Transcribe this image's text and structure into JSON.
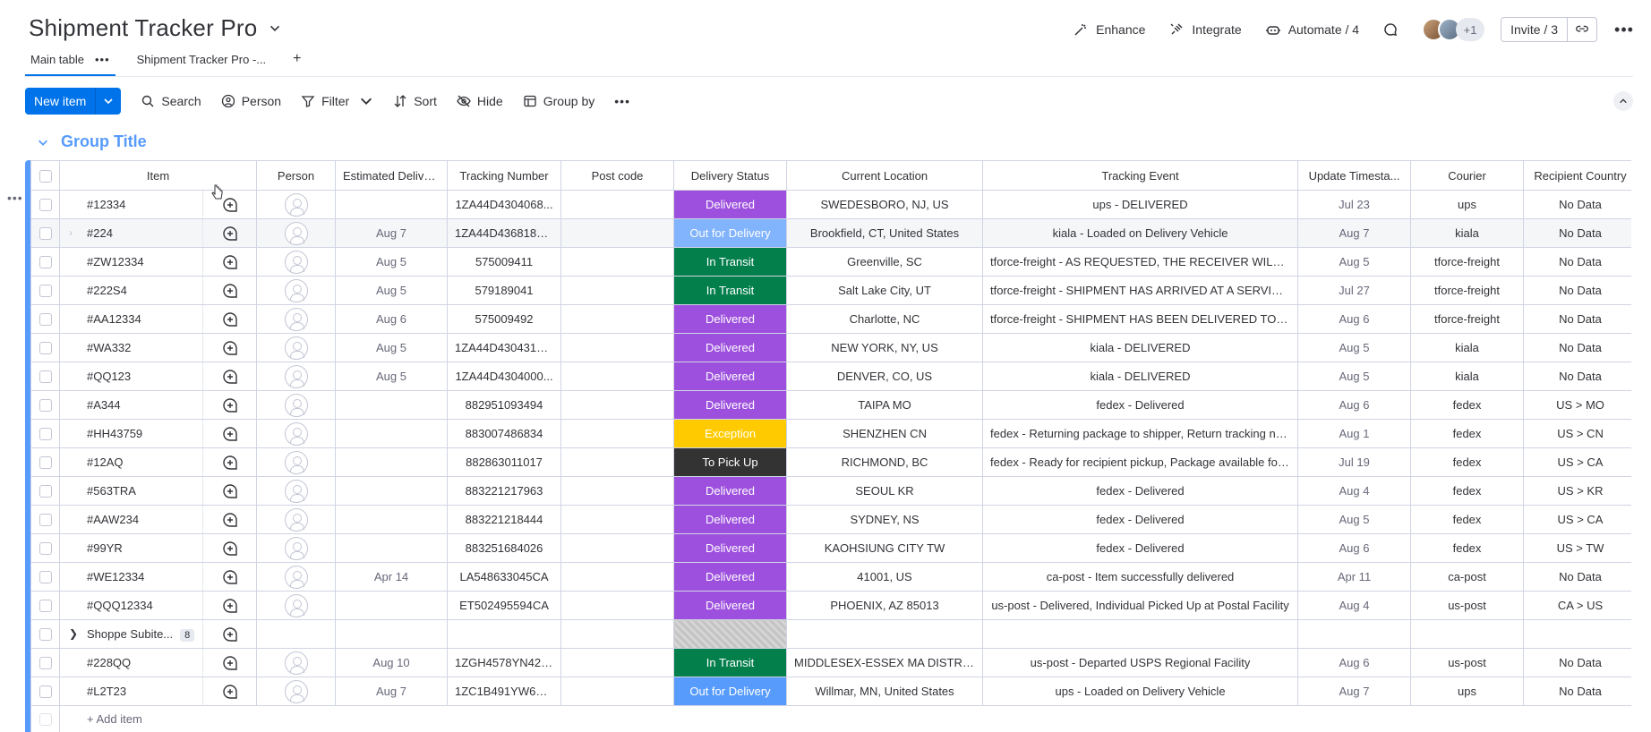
{
  "board": {
    "title": "Shipment Tracker Pro"
  },
  "top_actions": {
    "enhance": "Enhance",
    "integrate": "Integrate",
    "automate": "Automate / 4",
    "avatar_more": "+1",
    "invite": "Invite / 3"
  },
  "view_tabs": {
    "main": "Main table",
    "second": "Shipment Tracker Pro -...",
    "add": "+"
  },
  "toolbar": {
    "new_item": "New item",
    "search": "Search",
    "person": "Person",
    "filter": "Filter",
    "sort": "Sort",
    "hide": "Hide",
    "group_by": "Group by"
  },
  "group": {
    "title": "Group Title",
    "color": "#579bfc"
  },
  "columns": [
    "Item",
    "Person",
    "Estimated Delive...",
    "Tracking Number",
    "Post code",
    "Delivery Status",
    "Current Location",
    "Tracking Event",
    "Update Timesta...",
    "Courier",
    "Recipient Country"
  ],
  "status_colors": {
    "Delivered": "#9d50dd",
    "Out for Delivery": "#579bfc",
    "In Transit": "#037f4c",
    "Exception": "#ffcb00",
    "To Pick Up": "#333333"
  },
  "rows": [
    {
      "item": "#12334",
      "eta": "",
      "tracking": "1ZA44D4304068...",
      "post": "",
      "status": "Delivered",
      "location": "SWEDESBORO, NJ, US",
      "event": "ups - DELIVERED",
      "updated": "Jul 23",
      "courier": "ups",
      "country": "No Data"
    },
    {
      "item": "#224",
      "eta": "Aug 7",
      "tracking": "1ZA44D43681869...",
      "post": "",
      "status": "Out for Delivery",
      "location": "Brookfield, CT, United States",
      "event": "kiala - Loaded on Delivery Vehicle",
      "updated": "Aug 7",
      "courier": "kiala",
      "country": "No Data"
    },
    {
      "item": "#ZW12334",
      "eta": "Aug 5",
      "tracking": "575009411",
      "post": "",
      "status": "In Transit",
      "location": "Greenville, SC",
      "event": "tforce-freight - AS REQUESTED, THE RECEIVER WILL PIC...",
      "updated": "Aug 5",
      "courier": "tforce-freight",
      "country": "No Data"
    },
    {
      "item": "#222S4",
      "eta": "Aug 5",
      "tracking": "579189041",
      "post": "",
      "status": "In Transit",
      "location": "Salt Lake City, UT",
      "event": "tforce-freight - SHIPMENT HAS ARRIVED AT A SERVICE ...",
      "updated": "Jul 27",
      "courier": "tforce-freight",
      "country": "No Data"
    },
    {
      "item": "#AA12334",
      "eta": "Aug 6",
      "tracking": "575009492",
      "post": "",
      "status": "Delivered",
      "location": "Charlotte, NC",
      "event": "tforce-freight - SHIPMENT HAS BEEN DELIVERED TO TH...",
      "updated": "Aug 6",
      "courier": "tforce-freight",
      "country": "No Data"
    },
    {
      "item": "#WA332",
      "eta": "Aug 5",
      "tracking": "1ZA44D43043179...",
      "post": "",
      "status": "Delivered",
      "location": "NEW YORK, NY, US",
      "event": "kiala - DELIVERED",
      "updated": "Aug 5",
      "courier": "kiala",
      "country": "No Data"
    },
    {
      "item": "#QQ123",
      "eta": "Aug 5",
      "tracking": "1ZA44D4304000...",
      "post": "",
      "status": "Delivered",
      "location": "DENVER, CO, US",
      "event": "kiala - DELIVERED",
      "updated": "Aug 5",
      "courier": "kiala",
      "country": "No Data"
    },
    {
      "item": "#A344",
      "eta": "",
      "tracking": "882951093494",
      "post": "",
      "status": "Delivered",
      "location": "TAIPA MO",
      "event": "fedex - Delivered",
      "updated": "Aug 6",
      "courier": "fedex",
      "country": "US > MO"
    },
    {
      "item": "#HH43759",
      "eta": "",
      "tracking": "883007486834",
      "post": "",
      "status": "Exception",
      "location": "SHENZHEN CN",
      "event": "fedex - Returning package to shipper, Return tracking nu...",
      "updated": "Aug 1",
      "courier": "fedex",
      "country": "US > CN"
    },
    {
      "item": "#12AQ",
      "eta": "",
      "tracking": "882863011017",
      "post": "",
      "status": "To Pick Up",
      "location": "RICHMOND, BC",
      "event": "fedex - Ready for recipient pickup, Package available for p...",
      "updated": "Jul 19",
      "courier": "fedex",
      "country": "US > CA"
    },
    {
      "item": "#563TRA",
      "eta": "",
      "tracking": "883221217963",
      "post": "",
      "status": "Delivered",
      "location": "SEOUL KR",
      "event": "fedex - Delivered",
      "updated": "Aug 4",
      "courier": "fedex",
      "country": "US > KR"
    },
    {
      "item": "#AAW234",
      "eta": "",
      "tracking": "883221218444",
      "post": "",
      "status": "Delivered",
      "location": "SYDNEY, NS",
      "event": "fedex - Delivered",
      "updated": "Aug 5",
      "courier": "fedex",
      "country": "US > CA"
    },
    {
      "item": "#99YR",
      "eta": "",
      "tracking": "883251684026",
      "post": "",
      "status": "Delivered",
      "location": "KAOHSIUNG CITY TW",
      "event": "fedex - Delivered",
      "updated": "Aug 6",
      "courier": "fedex",
      "country": "US > TW"
    },
    {
      "item": "#WE12334",
      "eta": "Apr 14",
      "tracking": "LA548633045CA",
      "post": "",
      "status": "Delivered",
      "location": "41001, US",
      "event": "ca-post - Item successfully delivered",
      "updated": "Apr 11",
      "courier": "ca-post",
      "country": "No Data"
    },
    {
      "item": "#QQQ12334",
      "eta": "",
      "tracking": "ET502495594CA",
      "post": "",
      "status": "Delivered",
      "location": "PHOENIX, AZ 85013",
      "event": "us-post - Delivered, Individual Picked Up at Postal Facility",
      "updated": "Aug 4",
      "courier": "us-post",
      "country": "CA > US"
    },
    {
      "item": "Shoppe Subite...",
      "subitems": "8",
      "eta": "",
      "tracking": "",
      "post": "",
      "status": "",
      "location": "",
      "event": "",
      "updated": "",
      "courier": "",
      "country": ""
    },
    {
      "item": "#228QQ",
      "eta": "Aug 10",
      "tracking": "1ZGH4578YN429...",
      "post": "",
      "status": "In Transit",
      "location": "MIDDLESEX-ESSEX MA DISTRIBU...",
      "event": "us-post - Departed USPS Regional Facility",
      "updated": "Aug 6",
      "courier": "us-post",
      "country": "No Data"
    },
    {
      "item": "#L2T23",
      "eta": "Aug 7",
      "tracking": "1ZC1B491YW684...",
      "post": "",
      "status": "Out for Delivery",
      "location": "Willmar, MN, United States",
      "event": "ups - Loaded on Delivery Vehicle",
      "updated": "Aug 7",
      "courier": "ups",
      "country": "No Data"
    }
  ],
  "add_item": "+ Add item"
}
